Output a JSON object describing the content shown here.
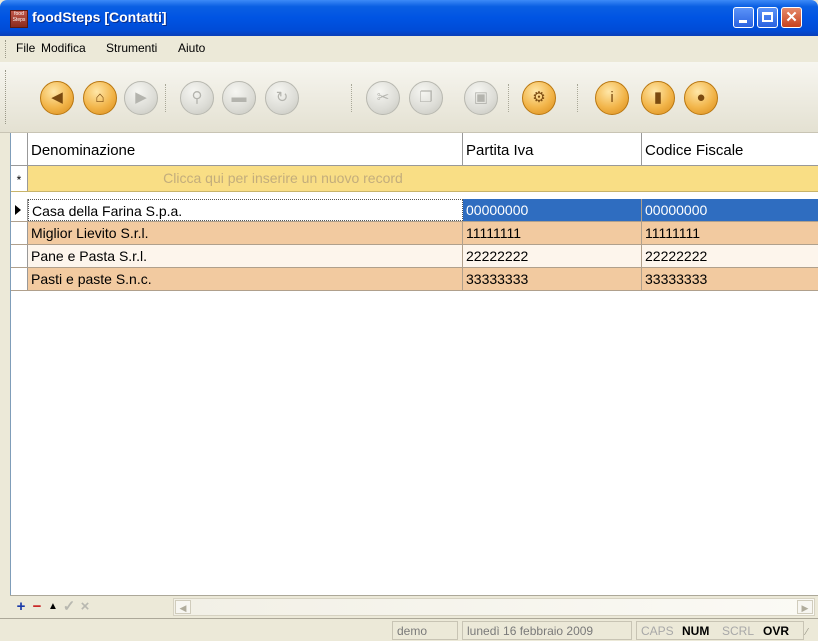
{
  "window": {
    "title": "foodSteps [Contatti]",
    "app_icon_text": "food Steps"
  },
  "menu": [
    "File",
    "Modifica",
    "Strumenti",
    "Aiuto"
  ],
  "toolbar_icons": [
    "back-icon",
    "home-icon",
    "forward-icon",
    "search-icon",
    "print-icon",
    "refresh-icon",
    "cut-icon",
    "copy-icon",
    "paste-icon",
    "settings-icon",
    "info-icon",
    "book-icon",
    "palette-icon"
  ],
  "grid": {
    "columns": [
      "Denominazione",
      "Partita Iva",
      "Codice Fiscale"
    ],
    "new_record_marker": "*",
    "new_record_hint": "Clicca qui per inserire un nuovo record",
    "rows": [
      {
        "name": "Casa della Farina S.p.a.",
        "piva": "00000000",
        "cf": "00000000"
      },
      {
        "name": "Miglior Lievito S.r.l.",
        "piva": "11111111",
        "cf": "11111111"
      },
      {
        "name": "Pane e Pasta S.r.l.",
        "piva": "22222222",
        "cf": "22222222"
      },
      {
        "name": "Pasti e paste S.n.c.",
        "piva": "33333333",
        "cf": "33333333"
      }
    ],
    "row_colors": {
      "odd": "#ffffff",
      "even": "#f2caa0",
      "selected": "#2f6dc0"
    }
  },
  "navigator": {
    "add": "+",
    "remove": "−",
    "up": "▲",
    "confirm": "✓",
    "cancel": "×"
  },
  "status": {
    "user": "demo",
    "date": "lunedì 16 febbraio 2009",
    "caps": "CAPS",
    "num": "NUM",
    "scrl": "SCRL",
    "ovr": "OVR"
  }
}
